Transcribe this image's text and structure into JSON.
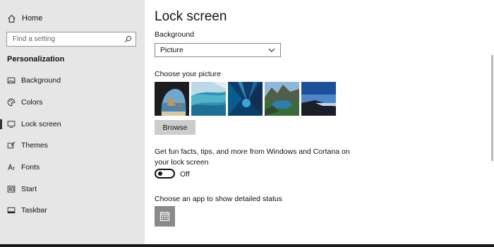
{
  "sidebar": {
    "home_label": "Home",
    "search_placeholder": "Find a setting",
    "section_title": "Personalization",
    "items": [
      {
        "label": "Background",
        "icon": "picture-icon"
      },
      {
        "label": "Colors",
        "icon": "palette-icon"
      },
      {
        "label": "Lock screen",
        "icon": "monitor-icon",
        "selected": true
      },
      {
        "label": "Themes",
        "icon": "brush-icon"
      },
      {
        "label": "Fonts",
        "icon": "font-icon"
      },
      {
        "label": "Start",
        "icon": "start-icon"
      },
      {
        "label": "Taskbar",
        "icon": "taskbar-icon"
      }
    ]
  },
  "main": {
    "title": "Lock screen",
    "background_label": "Background",
    "background_value": "Picture",
    "choose_picture_label": "Choose your picture",
    "browse_label": "Browse",
    "fun_facts_text": "Get fun facts, tips, and more from Windows and Cortana on your lock screen",
    "toggle_state": "Off",
    "detailed_status_label": "Choose an app to show detailed status"
  },
  "colors": {
    "sidebar_bg": "#e6e6e6",
    "button_bg": "#cccccc",
    "tile_bg": "#8a8a8a"
  }
}
